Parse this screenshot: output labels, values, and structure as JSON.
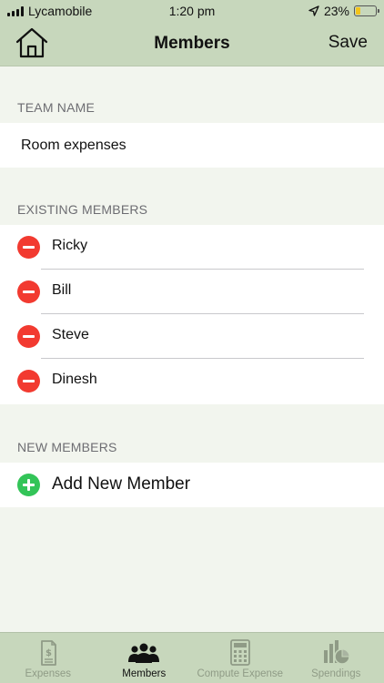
{
  "status_bar": {
    "carrier": "Lycamobile",
    "time": "1:20 pm",
    "battery_percent": "23%",
    "battery_level": 0.23
  },
  "nav": {
    "title": "Members",
    "save_label": "Save",
    "home_icon": "home-icon"
  },
  "team_section": {
    "header": "TEAM NAME",
    "team_name": "Room expenses"
  },
  "existing_section": {
    "header": "EXISTING MEMBERS",
    "members": [
      "Ricky",
      "Bill",
      "Steve",
      "Dinesh"
    ]
  },
  "new_section": {
    "header": "NEW MEMBERS",
    "add_label": "Add New Member"
  },
  "tabs": [
    {
      "label": "Expenses",
      "icon": "expense-doc-icon",
      "active": false
    },
    {
      "label": "Members",
      "icon": "group-icon",
      "active": true
    },
    {
      "label": "Compute Expense",
      "icon": "calculator-icon",
      "active": false
    },
    {
      "label": "Spendings",
      "icon": "pie-chart-icon",
      "active": false
    }
  ],
  "colors": {
    "bar_background": "#c7d7bc",
    "page_background": "#f2f5ee",
    "remove_red": "#f23a30",
    "add_green": "#33c458",
    "battery_yellow": "#f3c31a"
  }
}
